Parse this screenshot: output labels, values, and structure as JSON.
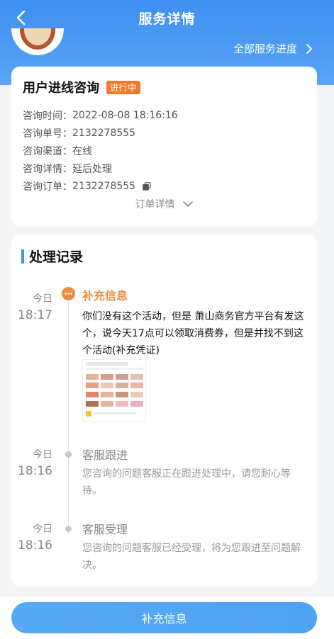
{
  "header": {
    "title": "服务详情",
    "all_progress": "全部服务进度"
  },
  "consult": {
    "title": "用户进线咨询",
    "status": "进行中",
    "fields": [
      {
        "label": "咨询时间：",
        "value": "2022-08-08 18:16:16"
      },
      {
        "label": "咨询单号：",
        "value": "2132278555"
      },
      {
        "label": "咨询渠道：",
        "value": "在线"
      },
      {
        "label": "咨询详情：",
        "value": "延后处理"
      },
      {
        "label": "咨询订单：",
        "value": "2132278555"
      }
    ],
    "order_detail": "订单详情"
  },
  "records": {
    "title": "处理记录",
    "items": [
      {
        "day": "今日",
        "time": "18:17",
        "title": "补充信息",
        "text": "你们没有这个活动，但是 萧山商务官方平台有发这个，说今天17点可以领取消费券，但是并找不到这个活动(补充凭证)"
      },
      {
        "day": "今日",
        "time": "18:16",
        "title": "客服跟进",
        "text": "您咨询的问题客服正在跟进处理中，请您耐心等待。"
      },
      {
        "day": "今日",
        "time": "18:16",
        "title": "客服受理",
        "text": "您咨询的问题客服已经受理，将为您跟进至问题解决。"
      }
    ]
  },
  "footer": {
    "button": "补充信息"
  },
  "colors": {
    "primary": "#3f8ff0",
    "accent": "#f08c3c",
    "badge": "#f07a2a"
  }
}
